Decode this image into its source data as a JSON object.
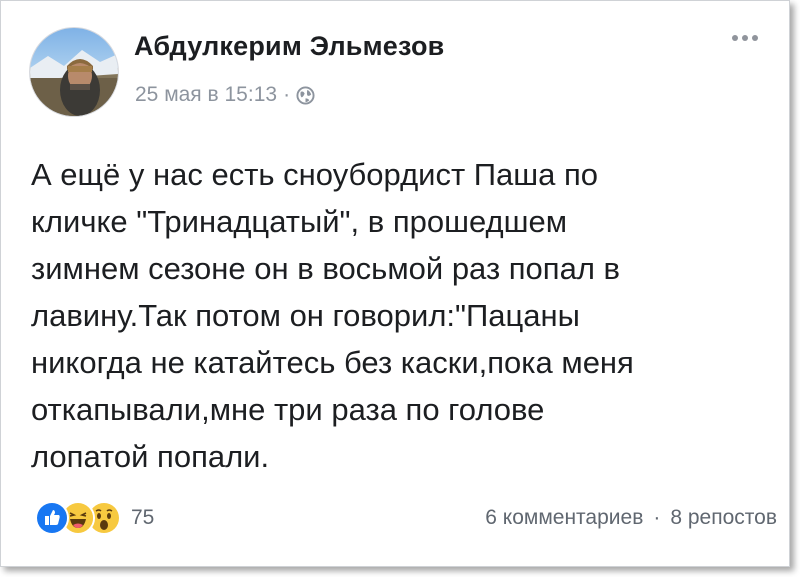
{
  "post": {
    "author": "Абдулкерим Эльмезов",
    "timestamp": "25 мая в 15:13",
    "separator": "·",
    "privacy_icon": "globe-icon",
    "more_icon": "more-options-icon",
    "text": "А ещё у нас есть сноубордист Паша по\nкличке \"Тринадцатый\",  в прошедшем\nзимнем сезоне он в восьмой раз попал в\nлавину.Так потом он говорил:\"Пацаны\nникогда не катайтесь без каски,пока меня\nоткапывали,мне три раза по голове\nлопатой попали."
  },
  "reactions": {
    "icons": [
      "like-icon",
      "haha-icon",
      "wow-icon"
    ],
    "count": "75"
  },
  "stats": {
    "comments": "6 комментариев",
    "separator": "·",
    "shares": "8 репостов"
  },
  "colors": {
    "author": "#1c1e21",
    "meta": "#8d949e",
    "like": "#1877f2",
    "emoji": "#f7c940"
  }
}
